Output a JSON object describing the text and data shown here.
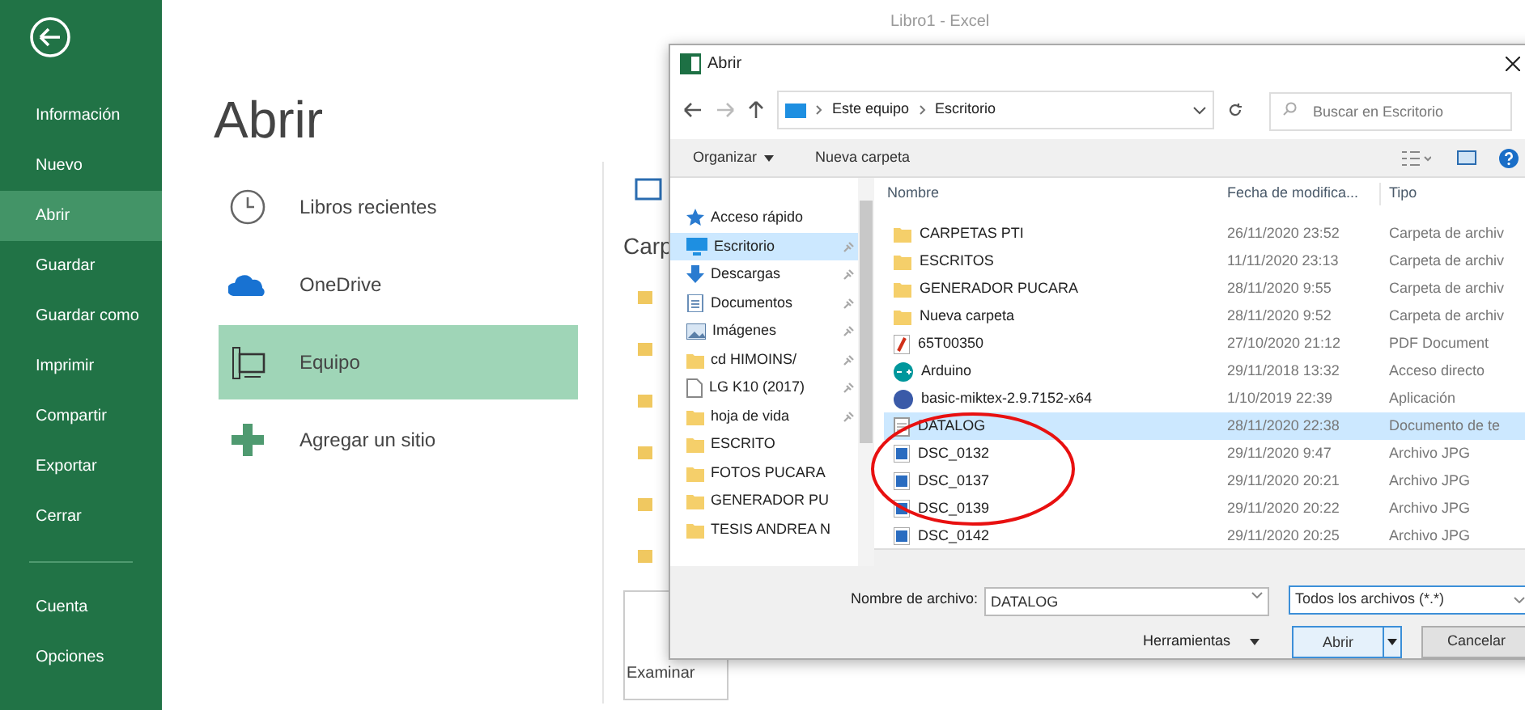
{
  "window": {
    "title": "Libro1 - Excel"
  },
  "sidebar": {
    "items": [
      {
        "label": "Información",
        "selected": false
      },
      {
        "label": "Nuevo",
        "selected": false
      },
      {
        "label": "Abrir",
        "selected": true
      },
      {
        "label": "Guardar",
        "selected": false
      },
      {
        "label": "Guardar como",
        "selected": false
      },
      {
        "label": "Imprimir",
        "selected": false
      },
      {
        "label": "Compartir",
        "selected": false
      },
      {
        "label": "Exportar",
        "selected": false
      },
      {
        "label": "Cerrar",
        "selected": false
      }
    ],
    "bottom_items": [
      {
        "label": "Cuenta"
      },
      {
        "label": "Opciones"
      }
    ]
  },
  "page": {
    "title": "Abrir",
    "places": [
      {
        "label": "Libros recientes",
        "kind": "clock",
        "selected": false
      },
      {
        "label": "OneDrive",
        "kind": "cloud",
        "selected": false
      },
      {
        "label": "Equipo",
        "kind": "computer",
        "selected": true
      },
      {
        "label": "Agregar un sitio",
        "kind": "plus",
        "selected": false
      }
    ],
    "panel_heading": "Carp",
    "browse_button": "Examinar"
  },
  "dialog": {
    "title": "Abrir",
    "path": [
      "Este equipo",
      "Escritorio"
    ],
    "search_placeholder": "Buscar en Escritorio",
    "toolbar": [
      "Organizar",
      "Nueva carpeta"
    ],
    "nav": [
      {
        "label": "Acceso rápido",
        "kind": "star",
        "pinned": false,
        "selected": false
      },
      {
        "label": "Escritorio",
        "kind": "desktop",
        "pinned": true,
        "selected": true
      },
      {
        "label": "Descargas",
        "kind": "download",
        "pinned": true,
        "selected": false
      },
      {
        "label": "Documentos",
        "kind": "document",
        "pinned": true,
        "selected": false
      },
      {
        "label": "Imágenes",
        "kind": "pictures",
        "pinned": true,
        "selected": false
      },
      {
        "label": "cd HIMOINS/",
        "kind": "folder",
        "pinned": true,
        "selected": false
      },
      {
        "label": "LG K10 (2017)",
        "kind": "file",
        "pinned": true,
        "selected": false
      },
      {
        "label": "hoja de vida",
        "kind": "folder",
        "pinned": true,
        "selected": false
      },
      {
        "label": "ESCRITO",
        "kind": "folder",
        "pinned": false,
        "selected": false
      },
      {
        "label": "FOTOS PUCARA",
        "kind": "folder",
        "pinned": false,
        "selected": false
      },
      {
        "label": "GENERADOR PU",
        "kind": "folder",
        "pinned": false,
        "selected": false
      },
      {
        "label": "TESIS ANDREA N",
        "kind": "folder",
        "pinned": false,
        "selected": false
      }
    ],
    "columns": [
      "Nombre",
      "Fecha de modifica...",
      "Tipo"
    ],
    "files": [
      {
        "name": "CARPETAS PTI",
        "date": "26/11/2020 23:52",
        "type": "Carpeta de archiv",
        "kind": "folder",
        "selected": false
      },
      {
        "name": "ESCRITOS",
        "date": "11/11/2020 23:13",
        "type": "Carpeta de archiv",
        "kind": "folder",
        "selected": false
      },
      {
        "name": "GENERADOR PUCARA",
        "date": "28/11/2020 9:55",
        "type": "Carpeta de archiv",
        "kind": "folder",
        "selected": false
      },
      {
        "name": "Nueva carpeta",
        "date": "28/11/2020 9:52",
        "type": "Carpeta de archiv",
        "kind": "folder",
        "selected": false
      },
      {
        "name": "65T00350",
        "date": "27/10/2020 21:12",
        "type": "PDF Document",
        "kind": "pdf",
        "selected": false
      },
      {
        "name": "Arduino",
        "date": "29/11/2018 13:32",
        "type": "Acceso directo",
        "kind": "arduino",
        "selected": false
      },
      {
        "name": "basic-miktex-2.9.7152-x64",
        "date": "1/10/2019 22:39",
        "type": "Aplicación",
        "kind": "app",
        "selected": false
      },
      {
        "name": "DATALOG",
        "date": "28/11/2020 22:38",
        "type": "Documento de te",
        "kind": "text",
        "selected": true
      },
      {
        "name": "DSC_0132",
        "date": "29/11/2020 9:47",
        "type": "Archivo JPG",
        "kind": "image",
        "selected": false
      },
      {
        "name": "DSC_0137",
        "date": "29/11/2020 20:21",
        "type": "Archivo JPG",
        "kind": "image",
        "selected": false
      },
      {
        "name": "DSC_0139",
        "date": "29/11/2020 20:22",
        "type": "Archivo JPG",
        "kind": "image",
        "selected": false
      },
      {
        "name": "DSC_0142",
        "date": "29/11/2020 20:25",
        "type": "Archivo JPG",
        "kind": "image",
        "selected": false
      }
    ],
    "filename_label": "Nombre de archivo:",
    "filename": "DATALOG",
    "filter": "Todos los archivos (*.*)",
    "tools": "Herramientas",
    "open_button": "Abrir",
    "cancel_button": "Cancelar"
  }
}
